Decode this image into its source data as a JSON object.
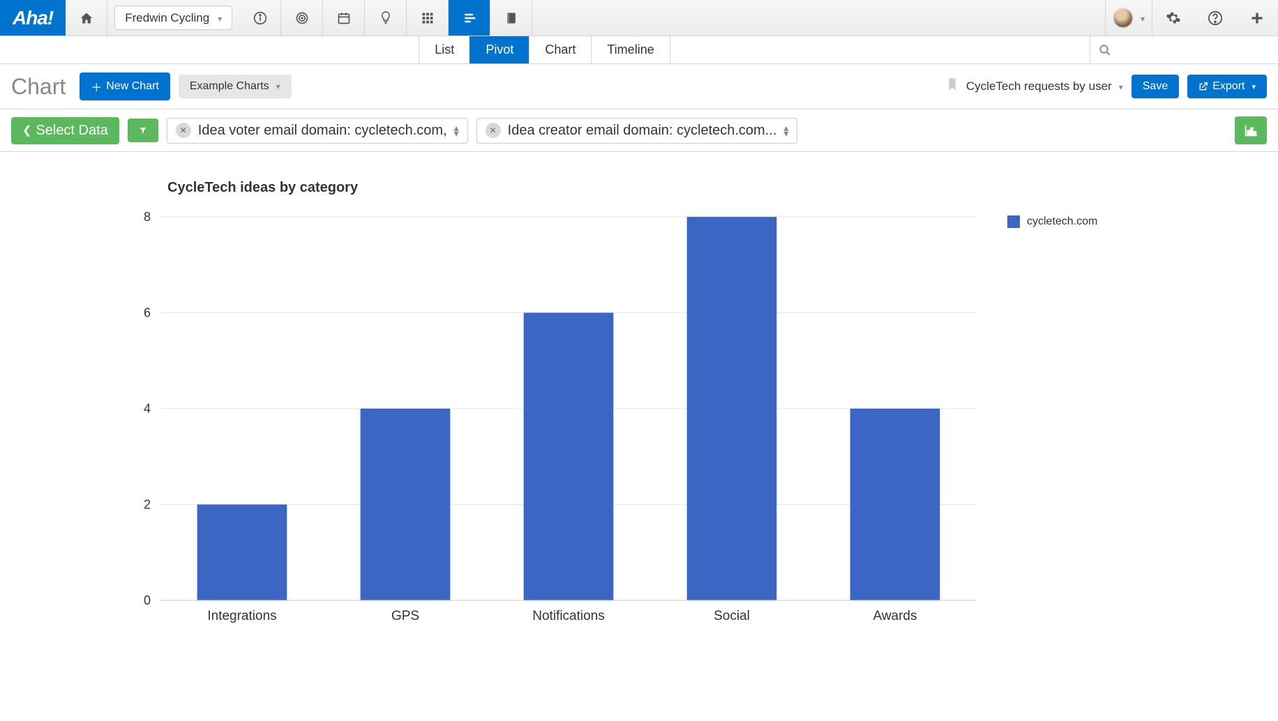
{
  "brand": "Aha!",
  "product_selector": "Fredwin Cycling",
  "view_tabs": [
    "List",
    "Pivot",
    "Chart",
    "Timeline"
  ],
  "active_view_tab": "Pivot",
  "page_title": "Chart",
  "toolbar": {
    "new_chart": "New Chart",
    "example_charts": "Example Charts",
    "report_name": "CycleTech requests by user",
    "save": "Save",
    "export": "Export"
  },
  "filterbar": {
    "select_data": "Select Data",
    "filter1": "Idea voter email domain: cycletech.com,",
    "filter2": "Idea creator email domain: cycletech.com..."
  },
  "search_placeholder": "",
  "legend": {
    "items": [
      "cycletech.com"
    ]
  },
  "chart_data": {
    "type": "bar",
    "title": "CycleTech ideas by category",
    "categories": [
      "Integrations",
      "GPS",
      "Notifications",
      "Social",
      "Awards"
    ],
    "series": [
      {
        "name": "cycletech.com",
        "values": [
          2,
          4,
          6,
          8,
          4
        ],
        "color": "#3b66c4"
      }
    ],
    "ylim": [
      0,
      8
    ],
    "yticks": [
      0,
      2,
      4,
      6,
      8
    ],
    "xlabel": "",
    "ylabel": ""
  }
}
